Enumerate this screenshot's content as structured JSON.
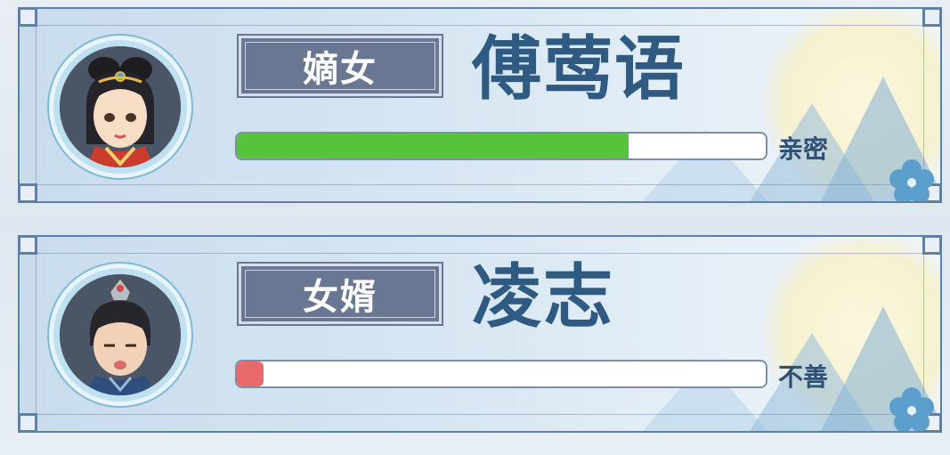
{
  "characters": [
    {
      "title": "嫡女",
      "name": "傅莺语",
      "relation_label": "亲密",
      "relation_level": 0.74,
      "bar_color": "#57c23c"
    },
    {
      "title": "女婿",
      "name": "凌志",
      "relation_label": "不善",
      "relation_level": 0.05,
      "bar_color": "#e86a6a"
    }
  ],
  "colors": {
    "frame": "#5f7fa4",
    "name_text": "#2f5a82",
    "title_box": "#6a7793"
  }
}
